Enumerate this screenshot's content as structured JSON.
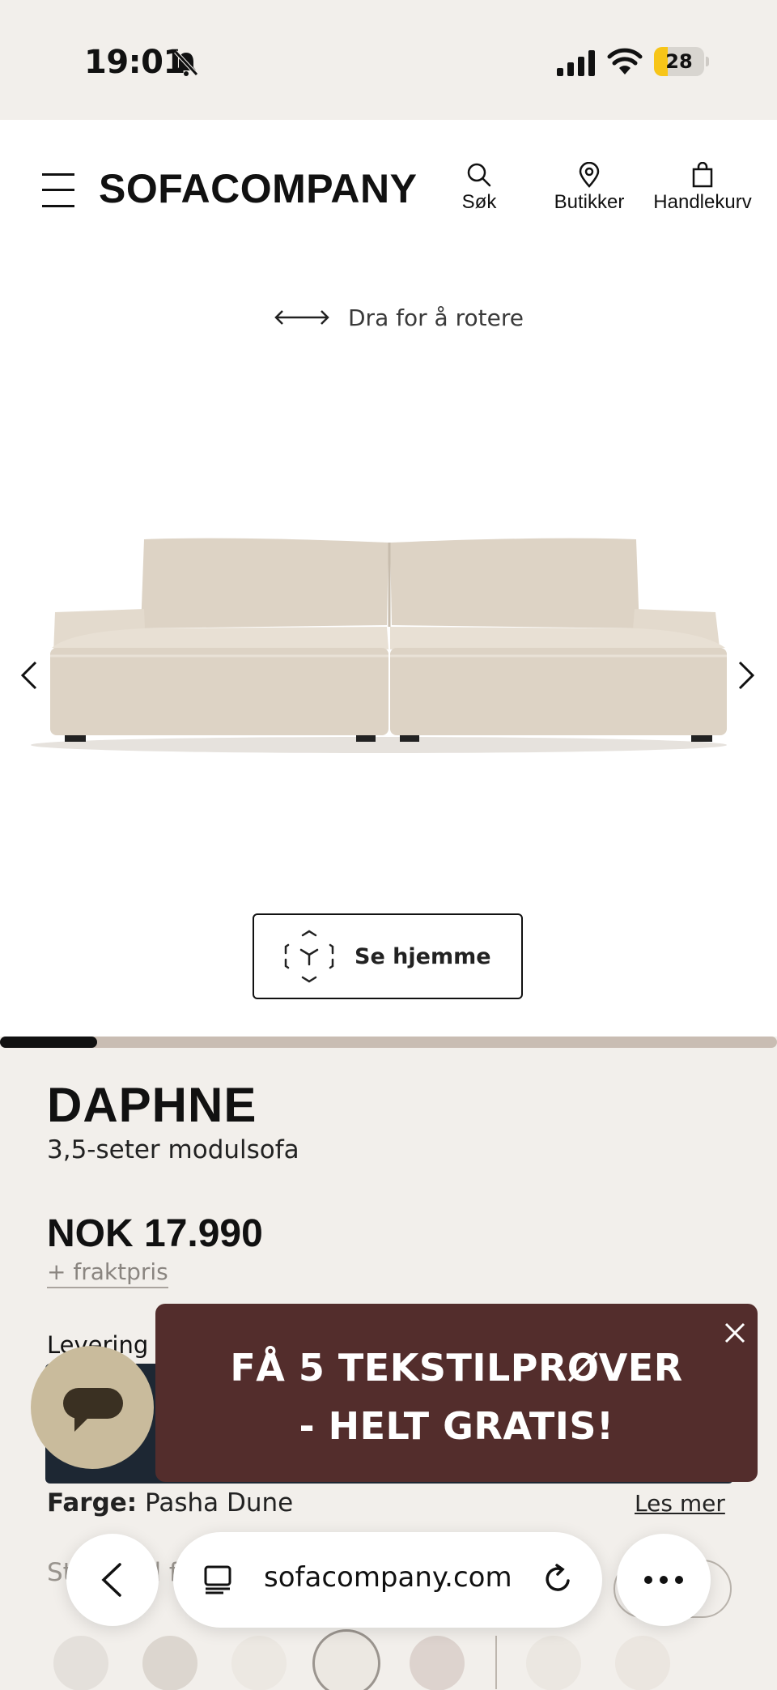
{
  "status_bar": {
    "time": "19:01",
    "battery_level": "28",
    "battery_fraction": 0.28,
    "battery_color": "#f7c518"
  },
  "header": {
    "logo": "SOFACOMPANY",
    "search_label": "Søk",
    "stores_label": "Butikker",
    "cart_label": "Handlekurv",
    "icons": [
      "menu-icon",
      "search-icon",
      "location-pin-icon",
      "shopping-bag-icon"
    ]
  },
  "viewer": {
    "rotate_hint": "Dra for å rotere",
    "ar_button_label": "Se hjemme",
    "gallery_progress": 0.125
  },
  "product": {
    "name": "DAPHNE",
    "subtitle": "3,5-seter modulsofa",
    "price": "NOK 17.990",
    "shipping_link": "+ fraktpris",
    "delivery_label": "Levering",
    "color_label": "Farge:",
    "color_value": "Pasha Dune",
    "read_more": "Les mer",
    "standard_label": "Standard f"
  },
  "promo": {
    "line1": "FÅ 5 TEKSTILPRØVER",
    "line2": "- HELT GRATIS!",
    "background": "#532d2c"
  },
  "browser": {
    "url": "sofacompany.com"
  },
  "colors": {
    "page_bg": "#f2efeb",
    "dark_bar": "#1d2733",
    "chat_button": "#c9bb9c",
    "progress_track": "#c9bdb3"
  },
  "swatches": [
    "#e4e0db",
    "#dcd6cf",
    "#ece8e2",
    "#ece8e2",
    "#ddd3ce",
    "#ebe7e1",
    "#ebe6e0"
  ]
}
